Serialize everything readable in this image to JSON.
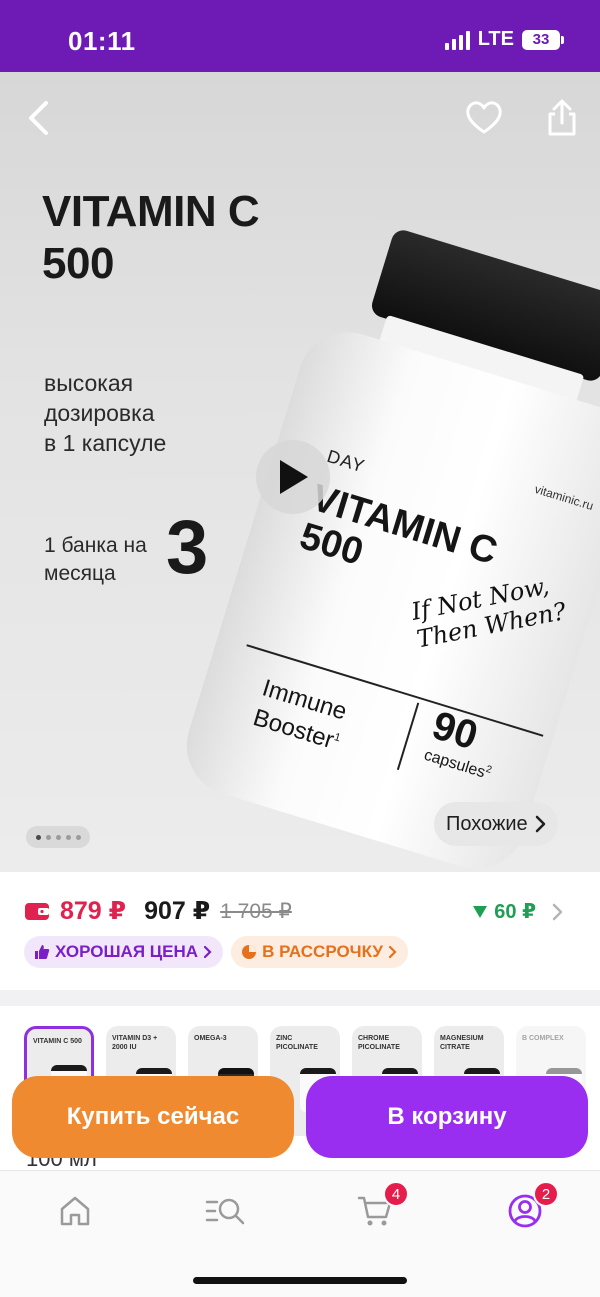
{
  "status_bar": {
    "time": "01:11",
    "network": "LTE",
    "battery": "33"
  },
  "hero": {
    "title_line1": "VITAMIN C",
    "title_line2": "500",
    "desc_line1": "высокая",
    "desc_line2": "дозировка",
    "desc_line3": "в 1 капсуле",
    "jar_line1": "1 банка на",
    "jar_line2": "месяца",
    "jar_number": "3",
    "similar_label": "Похожие",
    "bottle": {
      "site": "vitaminic.ru",
      "brand": "DAY",
      "name_line1": "VITAMIN C",
      "name_line2": "500",
      "script_line1": "If Not Now,",
      "script_line2": "Then When?",
      "booster_line1": "Immune",
      "booster_line2": "Booster",
      "booster_sup": "1",
      "caps_number": "90",
      "caps_label": "capsules",
      "caps_sup": "2"
    },
    "carousel": {
      "total": 5,
      "active": 1
    }
  },
  "pricing": {
    "card_price": "879 ₽",
    "price": "907 ₽",
    "old_price": "1 705 ₽",
    "discount": "60 ₽",
    "chip_good": "ХОРОШАЯ ЦЕНА",
    "chip_install": "В РАССРОЧКУ"
  },
  "thumbnails": [
    {
      "label": "VITAMIN C 500",
      "dark": false,
      "selected": true
    },
    {
      "label": "VITAMIN D3 + 2000 IU",
      "dark": false,
      "selected": false
    },
    {
      "label": "OMEGA-3",
      "dark": true,
      "selected": false
    },
    {
      "label": "ZINC PICOLINATE",
      "dark": false,
      "selected": false
    },
    {
      "label": "CHROME PICOLINATE",
      "dark": false,
      "selected": false
    },
    {
      "label": "MAGNESIUM CITRATE",
      "dark": false,
      "selected": false
    },
    {
      "label": "B COMPLEX",
      "dark": false,
      "selected": false
    }
  ],
  "partial_text": "100 мл",
  "actions": {
    "buy_now": "Купить сейчас",
    "add_to_cart": "В корзину"
  },
  "tab_bar": {
    "cart_badge": "4",
    "profile_badge": "2",
    "accent": "#9a2ef0"
  },
  "colors": {
    "status_bar": "#6e1bb5",
    "card_price": "#e0224f",
    "discount": "#1f9e55",
    "buy_button": "#ef8a31",
    "cart_button": "#9a2ef0"
  }
}
